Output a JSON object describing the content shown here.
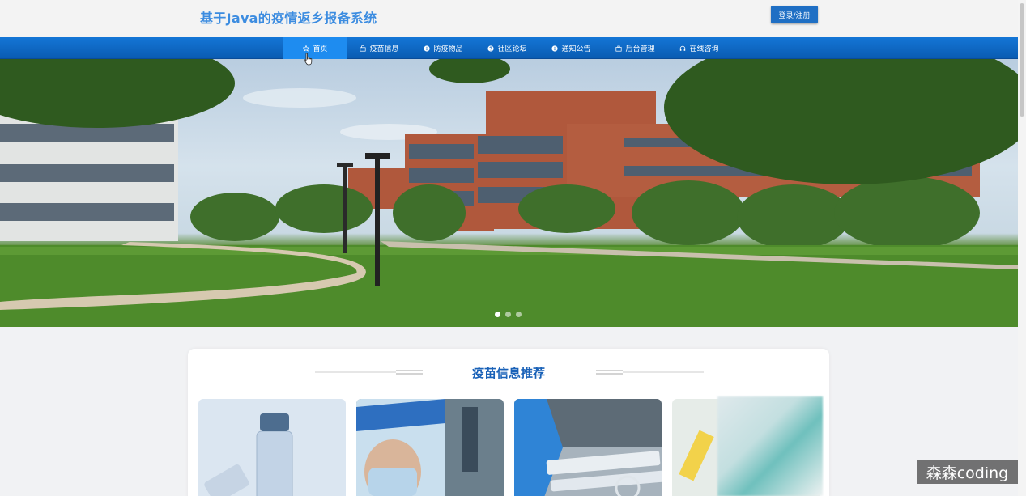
{
  "header": {
    "title": "基于Java的疫情返乡报备系统",
    "login_label": "登录/注册"
  },
  "nav": {
    "items": [
      {
        "label": "首页",
        "icon": "star-icon"
      },
      {
        "label": "疫苗信息",
        "icon": "bag-icon"
      },
      {
        "label": "防疫物品",
        "icon": "info-icon"
      },
      {
        "label": "社区论坛",
        "icon": "question-icon"
      },
      {
        "label": "通知公告",
        "icon": "info-icon"
      },
      {
        "label": "后台管理",
        "icon": "briefcase-icon"
      },
      {
        "label": "在线咨询",
        "icon": "headset-icon"
      }
    ],
    "active_index": 0
  },
  "carousel": {
    "slide_count": 3,
    "active_slide": 0
  },
  "section": {
    "title": "疫苗信息推荐"
  },
  "watermark": "森森coding",
  "colors": {
    "brand": "#3c8ce0",
    "nav": "#0d66c2",
    "nav_active": "#1e8cf0",
    "section_title": "#1a62b8"
  }
}
